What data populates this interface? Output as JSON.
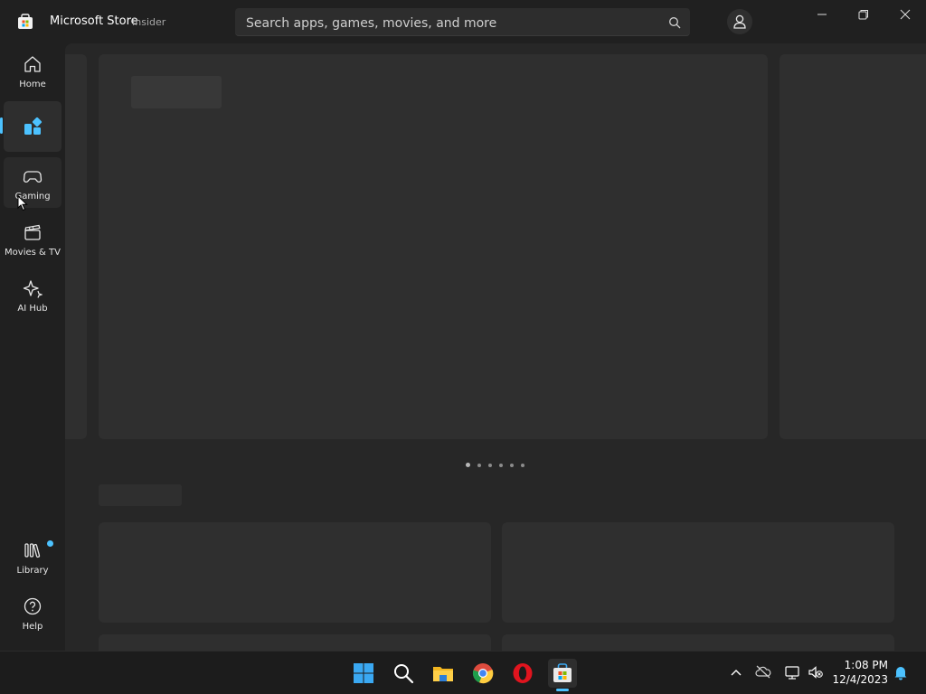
{
  "titlebar": {
    "app_name": "Microsoft Store",
    "app_badge": "Insider",
    "search_placeholder": "Search apps, games, movies, and more",
    "search_icon": "search-icon",
    "profile_icon": "person-icon",
    "window_controls": [
      "minimize",
      "restore",
      "close"
    ]
  },
  "sidebar": {
    "items": [
      {
        "label": "Home",
        "icon": "home-icon"
      },
      {
        "label": "",
        "icon": "apps-icon",
        "selected": true
      },
      {
        "label": "Gaming",
        "icon": "gamepad-icon"
      },
      {
        "label": "Movies & TV",
        "icon": "clapperboard-icon"
      },
      {
        "label": "AI Hub",
        "icon": "sparkle-icon"
      }
    ],
    "bottom_items": [
      {
        "label": "Library",
        "icon": "library-icon",
        "has_notification": true
      },
      {
        "label": "Help",
        "icon": "help-icon"
      }
    ]
  },
  "content": {
    "carousel_pages": 6,
    "carousel_active_index": 0,
    "state": "loading-skeleton"
  },
  "taskbar": {
    "pinned": [
      {
        "name": "Start",
        "icon": "windows-start-icon"
      },
      {
        "name": "Search",
        "icon": "search-icon"
      },
      {
        "name": "File Explorer",
        "icon": "folder-icon"
      },
      {
        "name": "Google Chrome",
        "icon": "chrome-icon"
      },
      {
        "name": "Opera",
        "icon": "opera-icon"
      },
      {
        "name": "Microsoft Store",
        "icon": "store-icon",
        "active": true
      }
    ],
    "tray": [
      "chevron-up-icon",
      "onedrive-icon",
      "network-icon",
      "volume-muted-icon"
    ],
    "time": "1:08 PM",
    "date": "12/4/2023",
    "notification_icon": "bell-icon"
  },
  "colors": {
    "accent": "#4cc2ff",
    "background": "#202020",
    "content": "#272727",
    "skeleton": "#2f2f2f"
  }
}
